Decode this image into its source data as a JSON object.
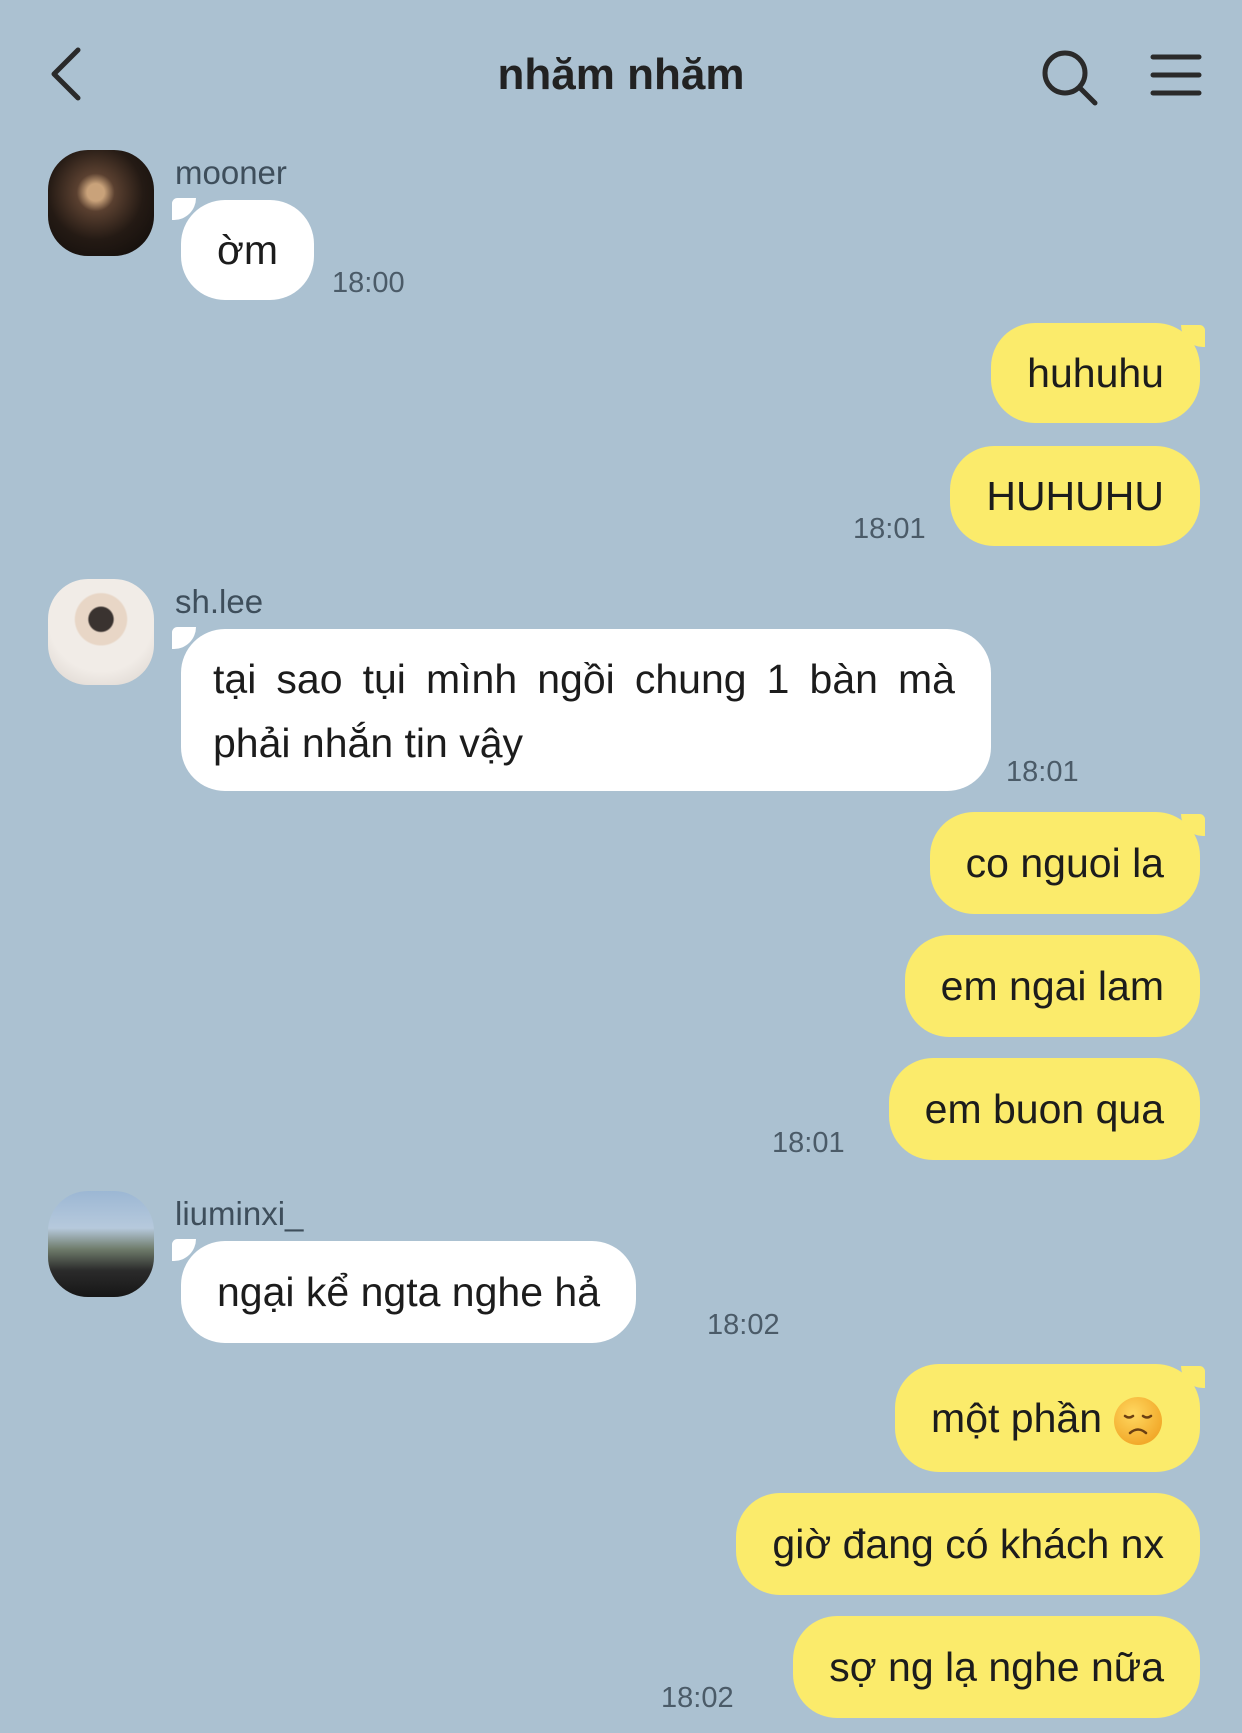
{
  "header": {
    "title": "nhăm nhăm",
    "back_icon": "chevron-left-icon",
    "search_icon": "search-icon",
    "menu_icon": "hamburger-menu-icon"
  },
  "colors": {
    "background": "#abc1d1",
    "incoming_bubble": "#ffffff",
    "outgoing_bubble": "#fbeb6b"
  },
  "messages": {
    "m1": {
      "sender": "mooner",
      "text": "ờm",
      "time": "18:00"
    },
    "o1": {
      "text": "huhuhu"
    },
    "o2": {
      "text": "HUHUHU",
      "time": "18:01"
    },
    "m2": {
      "sender": "sh.lee",
      "text": "tại sao tụi mình ngồi chung 1 bàn mà phải nhắn tin vậy",
      "time": "18:01"
    },
    "o3": {
      "text": "co nguoi la"
    },
    "o4": {
      "text": "em ngai lam"
    },
    "o5": {
      "text": "em buon qua",
      "time": "18:01"
    },
    "m3": {
      "sender": "liuminxi_",
      "text": "ngại kể ngta nghe hả",
      "time": "18:02"
    },
    "o6": {
      "text": "một phần",
      "emoji": "disappointed-face-emoji"
    },
    "o7": {
      "text": "giờ đang có khách nx"
    },
    "o8": {
      "text": "sợ ng lạ nghe nữa",
      "time": "18:02"
    }
  }
}
